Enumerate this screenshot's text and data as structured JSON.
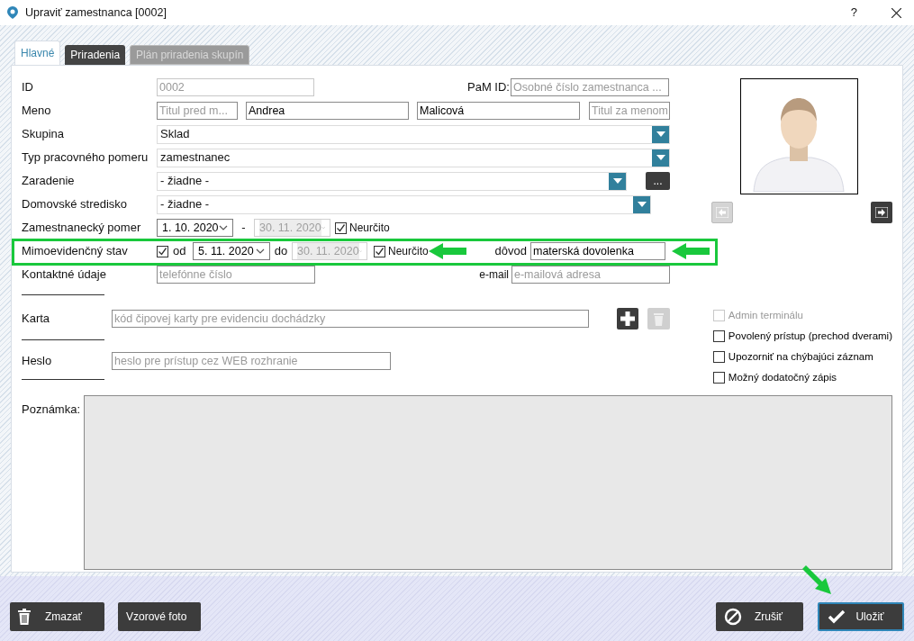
{
  "window": {
    "title": "Upraviť zamestnanca [0002]",
    "help": "?"
  },
  "tabs": [
    {
      "label": "Hlavné",
      "selected": true,
      "disabled": false
    },
    {
      "label": "Priradenia",
      "selected": false,
      "disabled": false
    },
    {
      "label": "Plán priradenia skupín",
      "selected": false,
      "disabled": true
    }
  ],
  "form": {
    "id": {
      "label": "ID",
      "value": "0002",
      "disabled": true
    },
    "pam_id": {
      "label": "PaM ID:",
      "placeholder": "Osobné číslo zamestnanca ..."
    },
    "name": {
      "label": "Meno",
      "title_before": {
        "placeholder": "Titul pred m..."
      },
      "first_name": "Andrea",
      "last_name": "Malicová",
      "title_after": {
        "placeholder": "Titul za menom"
      }
    },
    "group": {
      "label": "Skupina",
      "value": "Sklad"
    },
    "employment_type": {
      "label": "Typ pracovného pomeru",
      "value": "zamestnanec"
    },
    "assignment": {
      "label": "Zaradenie",
      "value": "- žiadne -",
      "more": "..."
    },
    "home_center": {
      "label": "Domovské stredisko",
      "value": "- žiadne -"
    },
    "employment": {
      "label": "Zamestnanecký pomer",
      "from": "1. 10. 2020",
      "separator": "-",
      "to": "30. 11. 2020",
      "indefinite": {
        "label": "Neurčito",
        "checked": true
      }
    },
    "off_record": {
      "label": "Mimoevidenčný stav",
      "checked": true,
      "from_label": "od",
      "from": "5. 11. 2020",
      "to_label": "do",
      "to": "30. 11. 2020",
      "indefinite": {
        "label": "Neurčito",
        "checked": true
      },
      "reason_label": "dôvod",
      "reason": "materská dovolenka",
      "highlighted": true
    },
    "contact": {
      "label": "Kontaktné údaje",
      "phone_placeholder": "telefónne číslo",
      "email_label": "e-mail",
      "email_placeholder": "e-mailová adresa"
    },
    "card": {
      "label": "Karta",
      "placeholder": "kód čipovej karty pre evidenciu dochádzky",
      "delete_disabled": true
    },
    "password": {
      "label": "Heslo",
      "placeholder": "heslo pre prístup cez WEB rozhranie"
    },
    "note": {
      "label": "Poznámka:"
    }
  },
  "photo": {
    "prev_disabled": true,
    "next_disabled": false
  },
  "options": [
    {
      "label": "Admin terminálu",
      "checked": false,
      "disabled": true
    },
    {
      "label": "Povolený prístup (prechod dverami)",
      "checked": false,
      "disabled": false
    },
    {
      "label": "Upozorniť na chýbajúci záznam",
      "checked": false,
      "disabled": false
    },
    {
      "label": "Možný dodatočný zápis",
      "checked": false,
      "disabled": false
    }
  ],
  "buttons": [
    {
      "kind": "delete",
      "label": "Zmazať"
    },
    {
      "kind": "plain",
      "label": "Vzorové foto"
    },
    {
      "kind": "cancel",
      "label": "Zrušiť"
    },
    {
      "kind": "save",
      "label": "Uložiť"
    }
  ]
}
